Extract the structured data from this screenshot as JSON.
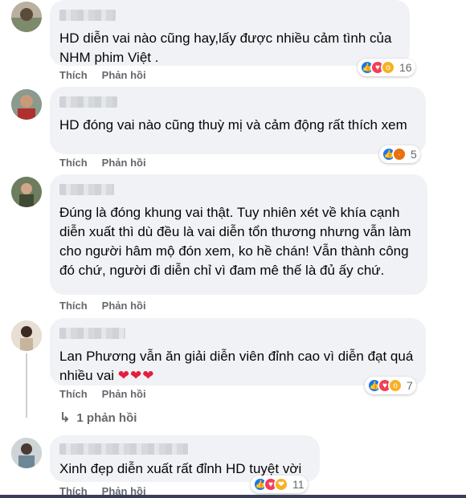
{
  "comments": [
    {
      "text": "HD diễn vai nào cũng hay,lấy được nhiều cảm tình của NHM phim Việt .",
      "like_label": "Thích",
      "reply_label": "Phản hồi",
      "reaction_count": "16"
    },
    {
      "text": "HD đóng vai nào cũng thuỳ mị và cảm động rất thích xem",
      "like_label": "Thích",
      "reply_label": "Phản hồi",
      "reaction_count": "5"
    },
    {
      "text": "Đúng là đóng khung vai thật. Tuy nhiên xét về khía cạnh diễn xuất thì dù đều là vai diễn tổn thương nhưng vẫn làm cho người hâm mộ đón xem, ko hề chán! Vẫn thành công đó chứ, người đi diễn chỉ vì đam mê thế là đủ ấy chứ.",
      "like_label": "Thích",
      "reply_label": "Phản hồi"
    },
    {
      "text": "Lan Phương vẫn ăn giải diễn viên đỉnh cao vì diễn đạt quá nhiều vai",
      "hearts": "❤❤❤",
      "like_label": "Thích",
      "reply_label": "Phản hồi",
      "reaction_count": "7",
      "replies_label": "1 phản hồi"
    },
    {
      "text": "Xinh đẹp diễn xuất rất đỉnh HD tuyệt vời",
      "like_label": "Thích",
      "reply_label": "Phản hồi",
      "reaction_count": "11"
    }
  ],
  "icons": {
    "like": "like-icon",
    "love": "love-icon",
    "wow": "wow-icon",
    "angry": "angry-icon",
    "care": "care-icon",
    "reply_arrow": "reply-arrow-icon"
  },
  "colors": {
    "bubble": "#f0f2f5",
    "secondary_text": "#65676b",
    "like_blue": "#1877f2",
    "love_red": "#f33e58"
  }
}
